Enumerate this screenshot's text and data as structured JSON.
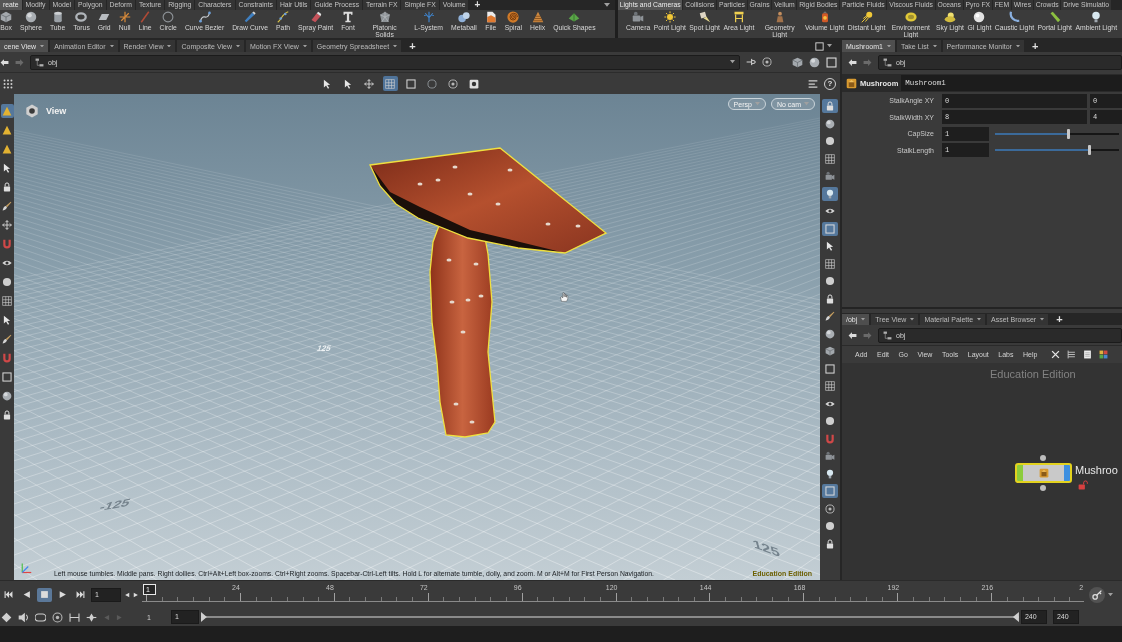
{
  "shelves": [
    {
      "tabs": [
        {
          "label": "reate",
          "selected": true
        },
        {
          "label": "Modify",
          "selected": false
        },
        {
          "label": "Model",
          "selected": false
        },
        {
          "label": "Polygon",
          "selected": false
        },
        {
          "label": "Deform",
          "selected": false
        },
        {
          "label": "Texture",
          "selected": false
        },
        {
          "label": "Rigging",
          "selected": false
        },
        {
          "label": "Characters",
          "selected": false
        },
        {
          "label": "Constraints",
          "selected": false
        },
        {
          "label": "Hair Utils",
          "selected": false
        },
        {
          "label": "Guide Process",
          "selected": false
        },
        {
          "label": "Terrain FX",
          "selected": false
        },
        {
          "label": "Simple FX",
          "selected": false
        },
        {
          "label": "Volume",
          "selected": false
        }
      ],
      "add_tab": "+",
      "tools": [
        "Box",
        "Sphere",
        "Tube",
        "Torus",
        "Grid",
        "Null",
        "Line",
        "Circle",
        "Curve Bezier",
        "Draw Curve",
        "Path",
        "Spray Paint",
        "Font",
        "Platonic Solids",
        "L-System",
        "Metaball",
        "File",
        "Spiral",
        "Helix",
        "Quick Shapes"
      ]
    },
    {
      "tabs": [
        {
          "label": "Lights and Cameras",
          "selected": true
        },
        {
          "label": "Collisions",
          "selected": false
        },
        {
          "label": "Particles",
          "selected": false
        },
        {
          "label": "Grains",
          "selected": false
        },
        {
          "label": "Vellum",
          "selected": false
        },
        {
          "label": "Rigid Bodies",
          "selected": false
        },
        {
          "label": "Particle Fluids",
          "selected": false
        },
        {
          "label": "Viscous Fluids",
          "selected": false
        },
        {
          "label": "Oceans",
          "selected": false
        },
        {
          "label": "Pyro FX",
          "selected": false
        },
        {
          "label": "FEM",
          "selected": false
        },
        {
          "label": "Wires",
          "selected": false
        },
        {
          "label": "Crowds",
          "selected": false
        },
        {
          "label": "Drive Simulatio",
          "selected": false
        }
      ],
      "tools": [
        "Camera",
        "Point Light",
        "Spot Light",
        "Area Light",
        "Geometry Light",
        "Volume Light",
        "Distant Light",
        "Environment Light",
        "Sky Light",
        "GI Light",
        "Caustic Light",
        "Portal Light",
        "Ambient Light"
      ]
    }
  ],
  "scene_panes": {
    "tabs": [
      {
        "label": "cene View",
        "selected": true
      },
      {
        "label": "Animation Editor",
        "selected": false
      },
      {
        "label": "Render View",
        "selected": false
      },
      {
        "label": "Composite View",
        "selected": false
      },
      {
        "label": "Motion FX View",
        "selected": false
      },
      {
        "label": "Geometry Spreadsheet",
        "selected": false
      }
    ],
    "add_tab": "+"
  },
  "parameter_panes": {
    "tabs": [
      {
        "label": "Mushroom1",
        "selected": true
      },
      {
        "label": "Take List",
        "selected": false
      },
      {
        "label": "Performance Monitor",
        "selected": false
      }
    ],
    "add_tab": "+"
  },
  "viewport": {
    "path": "obj",
    "toolbar": [
      {
        "selected": false
      },
      {
        "selected": false
      },
      {
        "selected": false
      },
      {
        "selected": true
      },
      {
        "selected": false
      },
      {
        "selected": false
      },
      {
        "selected": false
      },
      {
        "selected": false
      }
    ],
    "help": "?",
    "left_tools": [
      {
        "selected": true
      },
      {
        "selected": false
      },
      {
        "selected": false
      },
      {
        "selected": false
      },
      {
        "selected": false
      },
      {
        "selected": false
      },
      {
        "selected": false
      },
      {
        "selected": false
      },
      {
        "selected": false
      },
      {
        "selected": false
      },
      {
        "selected": false
      },
      {
        "selected": false
      },
      {
        "selected": false
      },
      {
        "selected": false
      },
      {
        "selected": false
      },
      {
        "selected": false
      },
      {
        "selected": false
      }
    ],
    "right_tools": [
      {
        "selected": true
      },
      {
        "selected": false
      },
      {
        "selected": false
      },
      {
        "selected": false
      },
      {
        "selected": false
      },
      {
        "selected": true
      },
      {
        "selected": false
      },
      {
        "selected": true
      },
      {
        "selected": false
      },
      {
        "selected": false
      },
      {
        "selected": false
      },
      {
        "selected": false
      },
      {
        "selected": false
      },
      {
        "selected": false
      },
      {
        "selected": false
      },
      {
        "selected": false
      },
      {
        "selected": false
      },
      {
        "selected": false
      },
      {
        "selected": false
      },
      {
        "selected": false
      },
      {
        "selected": false
      },
      {
        "selected": false
      },
      {
        "selected": true
      },
      {
        "selected": false
      },
      {
        "selected": false
      },
      {
        "selected": false
      }
    ],
    "title": "View",
    "camera_menus": [
      "Persp",
      "No cam"
    ],
    "grid_labels": [
      "125",
      "-125",
      "125"
    ],
    "hint": "Left mouse tumbles. Middle pans. Right dollies. Ctrl+Alt+Left box-zooms. Ctrl+Right zooms. Spacebar-Ctrl-Left tilts. Hold L for alternate tumble, dolly, and zoom. M or Alt+M for First Person Navigation.",
    "edition": "Education Edition"
  },
  "parameters": {
    "path": "obj",
    "node_type": "Mushroom",
    "node_name": "Mushroom1",
    "rows": [
      {
        "kind": "vector",
        "label": "StalkAngle XY",
        "values": [
          "0",
          "0"
        ]
      },
      {
        "kind": "vector",
        "label": "StalkWidth XY",
        "values": [
          "8",
          "4"
        ]
      },
      {
        "kind": "slider",
        "label": "CapSize",
        "value": "1",
        "level": 0.59
      },
      {
        "kind": "slider",
        "label": "StalkLength",
        "value": "1",
        "level": 0.76
      }
    ]
  },
  "network": {
    "tabs": [
      {
        "label": "/obj",
        "selected": true
      },
      {
        "label": "Tree View",
        "selected": false
      },
      {
        "label": "Material Palette",
        "selected": false
      },
      {
        "label": "Asset Browser",
        "selected": false
      }
    ],
    "add_tab": "+",
    "path": "obj",
    "menu": [
      "Add",
      "Edit",
      "Go",
      "View",
      "Tools",
      "Layout",
      "Labs",
      "Help"
    ],
    "edition": "Education Edition",
    "node": {
      "label": "Mushroo",
      "selected": true
    }
  },
  "timeline": {
    "transport": [
      {
        "kind": "first",
        "selected": false
      },
      {
        "kind": "back",
        "selected": false
      },
      {
        "kind": "stop",
        "selected": true
      },
      {
        "kind": "play",
        "selected": false
      },
      {
        "kind": "last",
        "selected": false
      }
    ],
    "frame": "1",
    "current_frame": "1",
    "ticks": [
      "24",
      "48",
      "72",
      "96",
      "120",
      "144",
      "168",
      "192",
      "216",
      "2"
    ],
    "start": "1",
    "range_start": "1",
    "range_handles": [
      {
        "kind": "start",
        "level": 0
      },
      {
        "kind": "end",
        "level": 1
      }
    ],
    "range_end": "240",
    "end": "240"
  }
}
